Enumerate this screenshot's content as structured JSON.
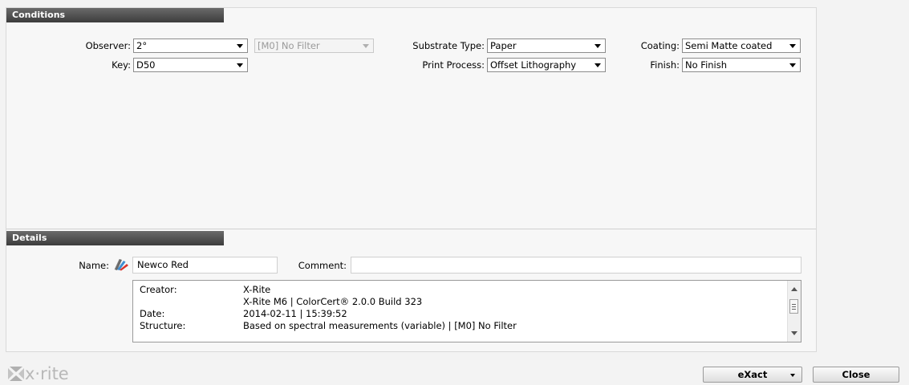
{
  "conditions": {
    "title": "Conditions",
    "observer_label": "Observer:",
    "observer_value": "2°",
    "filter_value": "[M0] No Filter",
    "key_label": "Key:",
    "key_value": "D50",
    "substrate_label": "Substrate Type:",
    "substrate_value": "Paper",
    "print_process_label": "Print Process:",
    "print_process_value": "Offset Lithography",
    "coating_label": "Coating:",
    "coating_value": "Semi Matte coated",
    "finish_label": "Finish:",
    "finish_value": "No Finish"
  },
  "details": {
    "title": "Details",
    "name_label": "Name:",
    "name_value": "Newco Red",
    "comment_label": "Comment:",
    "comment_value": "",
    "info": [
      {
        "key": "Creator:",
        "value": "X-Rite"
      },
      {
        "key": "",
        "value": "X-Rite M6 | ColorCert® 2.0.0 Build 323"
      },
      {
        "key": "Date:",
        "value": "2014-02-11 | 15:39:52"
      },
      {
        "key": "Structure:",
        "value": "Based on spectral measurements (variable) | [M0] No Filter"
      }
    ]
  },
  "footer": {
    "logo_text": "x·rite",
    "exact_label": "eXact",
    "close_label": "Close"
  },
  "icons": {
    "swatch": "swatch-fan-icon",
    "dropdown": "chevron-down-icon"
  }
}
